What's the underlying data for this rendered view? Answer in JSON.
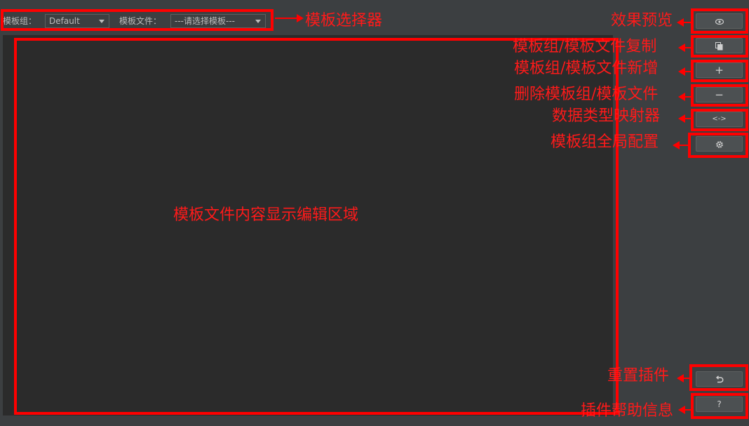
{
  "toolbar": {
    "group_label": "模板组：",
    "group_value": "Default",
    "file_label": "模板文件：",
    "file_value": "---请选择模板---"
  },
  "sidebar": {
    "copy_button": {
      "icon": "copy-icon"
    },
    "add_button": {
      "label": "+"
    },
    "remove_button": {
      "label": "−"
    },
    "mapper_button": {
      "label": "<->"
    },
    "help_button": {
      "label": "?"
    }
  },
  "annotations": {
    "template_selector": "模板选择器",
    "preview": "效果预览",
    "copy": "模板组/模板文件复制",
    "add": "模板组/模板文件新增",
    "remove": "删除模板组/模板文件",
    "mapper": "数据类型映射器",
    "global_config": "模板组全局配置",
    "editor_area": "模板文件内容显示编辑区域",
    "reset": "重置插件",
    "help": "插件帮助信息"
  },
  "colors": {
    "background": "#3c3f41",
    "editor": "#2b2b2b",
    "annotation": "#ff0000"
  }
}
